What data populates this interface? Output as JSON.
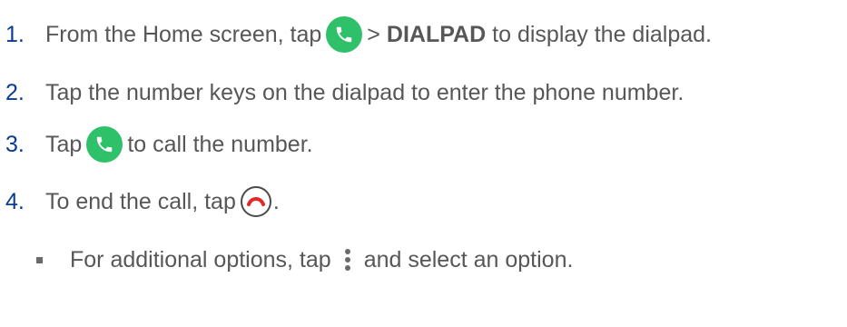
{
  "steps": [
    {
      "number": "1.",
      "text_before": "From the Home screen, tap",
      "separator": ">",
      "bold": "DIALPAD",
      "text_after": "to display the dialpad."
    },
    {
      "number": "2.",
      "text": "Tap the number keys on the dialpad to enter the phone number."
    },
    {
      "number": "3.",
      "text_before": "Tap",
      "text_after": "to call the number."
    },
    {
      "number": "4.",
      "text_before": "To end the call, tap",
      "text_after": "."
    }
  ],
  "bullet": {
    "text_before": "For additional options, tap",
    "text_after": "and select an option."
  },
  "icons": {
    "phone": "phone-icon",
    "end_call": "end-call-icon",
    "more_options": "more-options-icon"
  },
  "colors": {
    "number": "#0a3c8f",
    "text": "#575757",
    "phone_green": "#2fc06a",
    "end_call_red": "#e02a2a"
  }
}
